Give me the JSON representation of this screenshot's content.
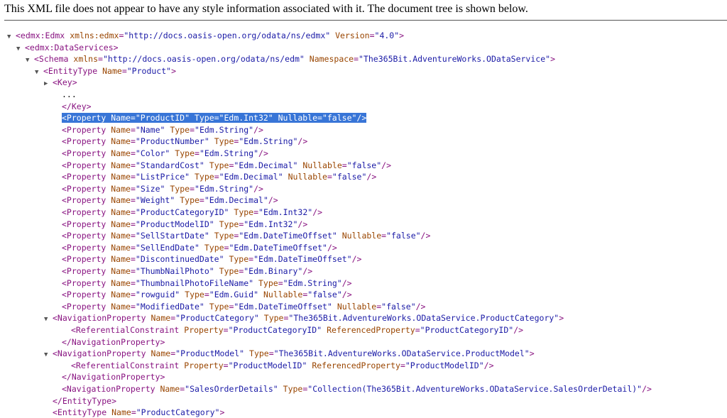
{
  "notice": "This XML file does not appear to have any style information associated with it. The document tree is shown below.",
  "tree": [
    {
      "indent": 0,
      "twisty": "▼",
      "html": "<span class='tg'>&lt;edmx:Edmx</span> <span class='an'>xmlns:edmx</span>=<span class='av'>\"http://docs.oasis-open.org/odata/ns/edmx\"</span> <span class='an'>Version</span>=<span class='av'>\"4.0\"</span><span class='tg'>&gt;</span>"
    },
    {
      "indent": 1,
      "twisty": "▼",
      "html": "<span class='tg'>&lt;edmx:DataServices&gt;</span>"
    },
    {
      "indent": 2,
      "twisty": "▼",
      "html": "<span class='tg'>&lt;Schema</span> <span class='an'>xmlns</span>=<span class='av'>\"http://docs.oasis-open.org/odata/ns/edm\"</span> <span class='an'>Namespace</span>=<span class='av'>\"The365Bit.AdventureWorks.ODataService\"</span><span class='tg'>&gt;</span>"
    },
    {
      "indent": 3,
      "twisty": "▼",
      "html": "<span class='tg'>&lt;EntityType</span> <span class='an'>Name</span>=<span class='av'>\"Product\"</span><span class='tg'>&gt;</span>"
    },
    {
      "indent": 4,
      "twisty": "▶",
      "html": "<span class='tg'>&lt;Key&gt;</span>"
    },
    {
      "indent": 5,
      "twisty": "",
      "html": "<span class='tx'>...</span>"
    },
    {
      "indent": 5,
      "twisty": "",
      "html": "<span class='tg'>&lt;/Key&gt;</span>"
    },
    {
      "indent": 5,
      "twisty": "",
      "sel": true,
      "html": "<span class='sel'>&lt;Property Name=\"ProductID\" Type=\"Edm.Int32\" Nullable=\"false\"/&gt;</span>"
    },
    {
      "indent": 5,
      "twisty": "",
      "html": "<span class='tg'>&lt;Property</span> <span class='an'>Name</span>=<span class='av'>\"Name\"</span> <span class='an'>Type</span>=<span class='av'>\"Edm.String\"</span><span class='tg'>/&gt;</span>"
    },
    {
      "indent": 5,
      "twisty": "",
      "html": "<span class='tg'>&lt;Property</span> <span class='an'>Name</span>=<span class='av'>\"ProductNumber\"</span> <span class='an'>Type</span>=<span class='av'>\"Edm.String\"</span><span class='tg'>/&gt;</span>"
    },
    {
      "indent": 5,
      "twisty": "",
      "html": "<span class='tg'>&lt;Property</span> <span class='an'>Name</span>=<span class='av'>\"Color\"</span> <span class='an'>Type</span>=<span class='av'>\"Edm.String\"</span><span class='tg'>/&gt;</span>"
    },
    {
      "indent": 5,
      "twisty": "",
      "html": "<span class='tg'>&lt;Property</span> <span class='an'>Name</span>=<span class='av'>\"StandardCost\"</span> <span class='an'>Type</span>=<span class='av'>\"Edm.Decimal\"</span> <span class='an'>Nullable</span>=<span class='av'>\"false\"</span><span class='tg'>/&gt;</span>"
    },
    {
      "indent": 5,
      "twisty": "",
      "html": "<span class='tg'>&lt;Property</span> <span class='an'>Name</span>=<span class='av'>\"ListPrice\"</span> <span class='an'>Type</span>=<span class='av'>\"Edm.Decimal\"</span> <span class='an'>Nullable</span>=<span class='av'>\"false\"</span><span class='tg'>/&gt;</span>"
    },
    {
      "indent": 5,
      "twisty": "",
      "html": "<span class='tg'>&lt;Property</span> <span class='an'>Name</span>=<span class='av'>\"Size\"</span> <span class='an'>Type</span>=<span class='av'>\"Edm.String\"</span><span class='tg'>/&gt;</span>"
    },
    {
      "indent": 5,
      "twisty": "",
      "html": "<span class='tg'>&lt;Property</span> <span class='an'>Name</span>=<span class='av'>\"Weight\"</span> <span class='an'>Type</span>=<span class='av'>\"Edm.Decimal\"</span><span class='tg'>/&gt;</span>"
    },
    {
      "indent": 5,
      "twisty": "",
      "html": "<span class='tg'>&lt;Property</span> <span class='an'>Name</span>=<span class='av'>\"ProductCategoryID\"</span> <span class='an'>Type</span>=<span class='av'>\"Edm.Int32\"</span><span class='tg'>/&gt;</span>"
    },
    {
      "indent": 5,
      "twisty": "",
      "html": "<span class='tg'>&lt;Property</span> <span class='an'>Name</span>=<span class='av'>\"ProductModelID\"</span> <span class='an'>Type</span>=<span class='av'>\"Edm.Int32\"</span><span class='tg'>/&gt;</span>"
    },
    {
      "indent": 5,
      "twisty": "",
      "html": "<span class='tg'>&lt;Property</span> <span class='an'>Name</span>=<span class='av'>\"SellStartDate\"</span> <span class='an'>Type</span>=<span class='av'>\"Edm.DateTimeOffset\"</span> <span class='an'>Nullable</span>=<span class='av'>\"false\"</span><span class='tg'>/&gt;</span>"
    },
    {
      "indent": 5,
      "twisty": "",
      "html": "<span class='tg'>&lt;Property</span> <span class='an'>Name</span>=<span class='av'>\"SellEndDate\"</span> <span class='an'>Type</span>=<span class='av'>\"Edm.DateTimeOffset\"</span><span class='tg'>/&gt;</span>"
    },
    {
      "indent": 5,
      "twisty": "",
      "html": "<span class='tg'>&lt;Property</span> <span class='an'>Name</span>=<span class='av'>\"DiscontinuedDate\"</span> <span class='an'>Type</span>=<span class='av'>\"Edm.DateTimeOffset\"</span><span class='tg'>/&gt;</span>"
    },
    {
      "indent": 5,
      "twisty": "",
      "html": "<span class='tg'>&lt;Property</span> <span class='an'>Name</span>=<span class='av'>\"ThumbNailPhoto\"</span> <span class='an'>Type</span>=<span class='av'>\"Edm.Binary\"</span><span class='tg'>/&gt;</span>"
    },
    {
      "indent": 5,
      "twisty": "",
      "html": "<span class='tg'>&lt;Property</span> <span class='an'>Name</span>=<span class='av'>\"ThumbnailPhotoFileName\"</span> <span class='an'>Type</span>=<span class='av'>\"Edm.String\"</span><span class='tg'>/&gt;</span>"
    },
    {
      "indent": 5,
      "twisty": "",
      "html": "<span class='tg'>&lt;Property</span> <span class='an'>Name</span>=<span class='av'>\"rowguid\"</span> <span class='an'>Type</span>=<span class='av'>\"Edm.Guid\"</span> <span class='an'>Nullable</span>=<span class='av'>\"false\"</span><span class='tg'>/&gt;</span>"
    },
    {
      "indent": 5,
      "twisty": "",
      "html": "<span class='tg'>&lt;Property</span> <span class='an'>Name</span>=<span class='av'>\"ModifiedDate\"</span> <span class='an'>Type</span>=<span class='av'>\"Edm.DateTimeOffset\"</span> <span class='an'>Nullable</span>=<span class='av'>\"false\"</span><span class='tg'>/&gt;</span>"
    },
    {
      "indent": 4,
      "twisty": "▼",
      "html": "<span class='tg'>&lt;NavigationProperty</span> <span class='an'>Name</span>=<span class='av'>\"ProductCategory\"</span> <span class='an'>Type</span>=<span class='av'>\"The365Bit.AdventureWorks.ODataService.ProductCategory\"</span><span class='tg'>&gt;</span>"
    },
    {
      "indent": 6,
      "twisty": "",
      "html": "<span class='tg'>&lt;ReferentialConstraint</span> <span class='an'>Property</span>=<span class='av'>\"ProductCategoryID\"</span> <span class='an'>ReferencedProperty</span>=<span class='av'>\"ProductCategoryID\"</span><span class='tg'>/&gt;</span>"
    },
    {
      "indent": 5,
      "twisty": "",
      "html": "<span class='tg'>&lt;/NavigationProperty&gt;</span>"
    },
    {
      "indent": 4,
      "twisty": "▼",
      "html": "<span class='tg'>&lt;NavigationProperty</span> <span class='an'>Name</span>=<span class='av'>\"ProductModel\"</span> <span class='an'>Type</span>=<span class='av'>\"The365Bit.AdventureWorks.ODataService.ProductModel\"</span><span class='tg'>&gt;</span>"
    },
    {
      "indent": 6,
      "twisty": "",
      "html": "<span class='tg'>&lt;ReferentialConstraint</span> <span class='an'>Property</span>=<span class='av'>\"ProductModelID\"</span> <span class='an'>ReferencedProperty</span>=<span class='av'>\"ProductModelID\"</span><span class='tg'>/&gt;</span>"
    },
    {
      "indent": 5,
      "twisty": "",
      "html": "<span class='tg'>&lt;/NavigationProperty&gt;</span>"
    },
    {
      "indent": 5,
      "twisty": "",
      "html": "<span class='tg'>&lt;NavigationProperty</span> <span class='an'>Name</span>=<span class='av'>\"SalesOrderDetails\"</span> <span class='an'>Type</span>=<span class='av'>\"Collection(The365Bit.AdventureWorks.ODataService.SalesOrderDetail)\"</span><span class='tg'>/&gt;</span>"
    },
    {
      "indent": 4,
      "twisty": "",
      "html": "<span class='tg'>&lt;/EntityType&gt;</span>"
    },
    {
      "indent": 4,
      "twisty": "",
      "html": "<span class='tg'>&lt;EntityType</span> <span class='an'>Name</span>=<span class='av'>\"ProductCategory\"</span><span class='tg'>&gt;</span>"
    }
  ]
}
